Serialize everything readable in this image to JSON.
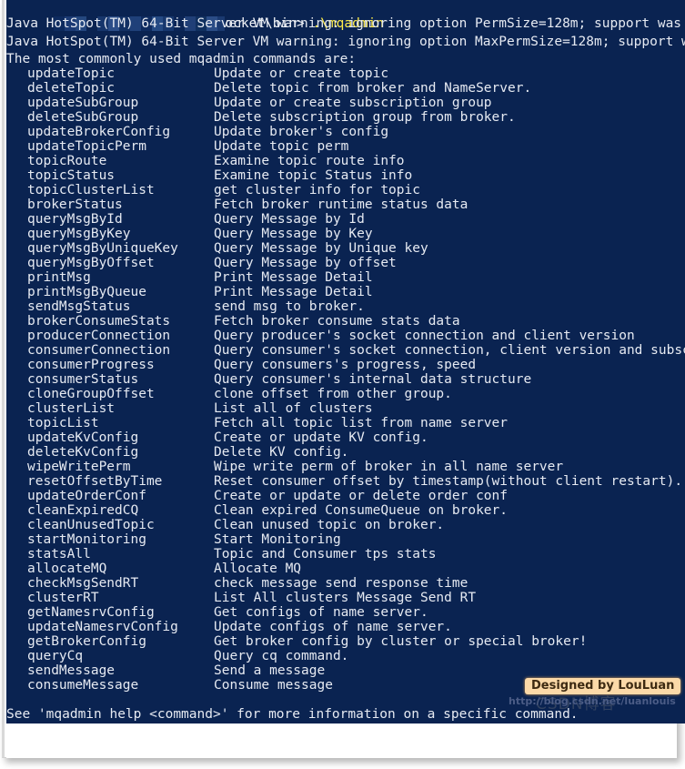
{
  "window": {
    "console_background": "#0a2351",
    "text_color": "#e6eaf2",
    "accent_color": "#ffec4a"
  },
  "prompt": {
    "redacted_path_prefix": "",
    "visible_path": "ocket\\bin>",
    "command": ".\\mqadmin"
  },
  "output": {
    "warnings": [
      "Java HotSpot(TM) 64-Bit Server VM warning: ignoring option PermSize=128m; support was removed",
      "Java HotSpot(TM) 64-Bit Server VM warning: ignoring option MaxPermSize=128m; support was remo"
    ],
    "intro": "The most commonly used mqadmin commands are:",
    "footer": "See 'mqadmin help <command>' for more information on a specific command."
  },
  "commands": [
    {
      "name": "updateTopic",
      "desc": "Update or create topic"
    },
    {
      "name": "deleteTopic",
      "desc": "Delete topic from broker and NameServer."
    },
    {
      "name": "updateSubGroup",
      "desc": "Update or create subscription group"
    },
    {
      "name": "deleteSubGroup",
      "desc": "Delete subscription group from broker."
    },
    {
      "name": "updateBrokerConfig",
      "desc": "Update broker's config"
    },
    {
      "name": "updateTopicPerm",
      "desc": "Update topic perm"
    },
    {
      "name": "topicRoute",
      "desc": "Examine topic route info"
    },
    {
      "name": "topicStatus",
      "desc": "Examine topic Status info"
    },
    {
      "name": "topicClusterList",
      "desc": "get cluster info for topic"
    },
    {
      "name": "brokerStatus",
      "desc": "Fetch broker runtime status data"
    },
    {
      "name": "queryMsgById",
      "desc": "Query Message by Id"
    },
    {
      "name": "queryMsgByKey",
      "desc": "Query Message by Key"
    },
    {
      "name": "queryMsgByUniqueKey",
      "desc": "Query Message by Unique key"
    },
    {
      "name": "queryMsgByOffset",
      "desc": "Query Message by offset"
    },
    {
      "name": "printMsg",
      "desc": "Print Message Detail"
    },
    {
      "name": "printMsgByQueue",
      "desc": "Print Message Detail"
    },
    {
      "name": "sendMsgStatus",
      "desc": "send msg to broker."
    },
    {
      "name": "brokerConsumeStats",
      "desc": "Fetch broker consume stats data"
    },
    {
      "name": "producerConnection",
      "desc": "Query producer's socket connection and client version"
    },
    {
      "name": "consumerConnection",
      "desc": "Query consumer's socket connection, client version and subscription"
    },
    {
      "name": "consumerProgress",
      "desc": "Query consumers's progress, speed"
    },
    {
      "name": "consumerStatus",
      "desc": "Query consumer's internal data structure"
    },
    {
      "name": "cloneGroupOffset",
      "desc": "clone offset from other group."
    },
    {
      "name": "clusterList",
      "desc": "List all of clusters"
    },
    {
      "name": "topicList",
      "desc": "Fetch all topic list from name server"
    },
    {
      "name": "updateKvConfig",
      "desc": "Create or update KV config."
    },
    {
      "name": "deleteKvConfig",
      "desc": "Delete KV config."
    },
    {
      "name": "wipeWritePerm",
      "desc": "Wipe write perm of broker in all name server"
    },
    {
      "name": "resetOffsetByTime",
      "desc": "Reset consumer offset by timestamp(without client restart)."
    },
    {
      "name": "updateOrderConf",
      "desc": "Create or update or delete order conf"
    },
    {
      "name": "cleanExpiredCQ",
      "desc": "Clean expired ConsumeQueue on broker."
    },
    {
      "name": "cleanUnusedTopic",
      "desc": "Clean unused topic on broker."
    },
    {
      "name": "startMonitoring",
      "desc": "Start Monitoring"
    },
    {
      "name": "statsAll",
      "desc": "Topic and Consumer tps stats"
    },
    {
      "name": "allocateMQ",
      "desc": "Allocate MQ"
    },
    {
      "name": "checkMsgSendRT",
      "desc": "check message send response time"
    },
    {
      "name": "clusterRT",
      "desc": "List All clusters Message Send RT"
    },
    {
      "name": "getNamesrvConfig",
      "desc": "Get configs of name server."
    },
    {
      "name": "updateNamesrvConfig",
      "desc": "Update configs of name server."
    },
    {
      "name": "getBrokerConfig",
      "desc": "Get broker config by cluster or special broker!"
    },
    {
      "name": "queryCq",
      "desc": "Query cq command."
    },
    {
      "name": "sendMessage",
      "desc": "Send a message"
    },
    {
      "name": "consumeMessage",
      "desc": "Consume message"
    }
  ],
  "watermark": {
    "title": "Designed by LouLuan",
    "url": "http://blog.csdn.net/luanlouis",
    "ghost": "CSDN博客"
  }
}
